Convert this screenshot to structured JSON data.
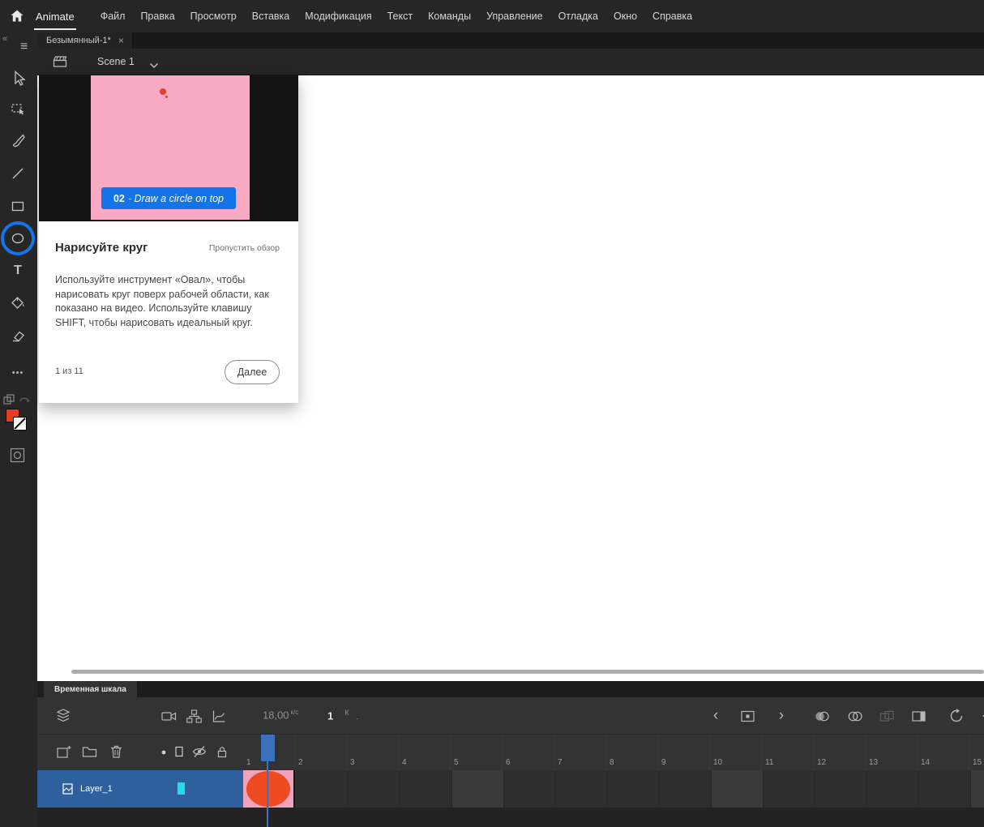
{
  "menu": {
    "app": "Animate",
    "items": [
      "Файл",
      "Правка",
      "Просмотр",
      "Вставка",
      "Модификация",
      "Текст",
      "Команды",
      "Управление",
      "Отладка",
      "Окно",
      "Справка"
    ]
  },
  "doc_tab": {
    "title": "Безымянный-1*",
    "close": "×"
  },
  "scene_bar": {
    "scene": "Scene 1"
  },
  "tools_panel": {
    "collapse": "«",
    "menu_icon": "≡",
    "more_icon": "•••",
    "text_tool": "T"
  },
  "tutorial": {
    "caption_num": "02",
    "caption_text": "- Draw a circle on top",
    "title": "Нарисуйте круг",
    "skip_label": "Пропустить обзор",
    "body": "Используйте инструмент «Овал», чтобы нарисовать круг поверх рабочей области, как показано на видео. Используйте клавишу SHIFT, чтобы нарисовать идеальный круг.",
    "progress": "1 из 11",
    "next_label": "Далее"
  },
  "timeline": {
    "tab_label": "Временная шкала",
    "fps": "18,00",
    "fps_unit": "к/с",
    "current_frame": "1",
    "frame_unit": "К",
    "frame_suffix": ".",
    "layer_name": "Layer_1",
    "ruler": [
      "1",
      "2",
      "3",
      "4",
      "5",
      "6",
      "7",
      "8",
      "9",
      "10",
      "11",
      "12",
      "13",
      "14",
      "15"
    ],
    "chevron_left": "‹",
    "chevron_right": "›"
  },
  "colors": {
    "accent_blue": "#1473e6",
    "stage_pink": "#f8a9c4",
    "shape_red": "#ef4b22",
    "selected_layer": "#2e5f9e",
    "playhead": "#3b71bd",
    "cyan_chip": "#25dde8"
  }
}
